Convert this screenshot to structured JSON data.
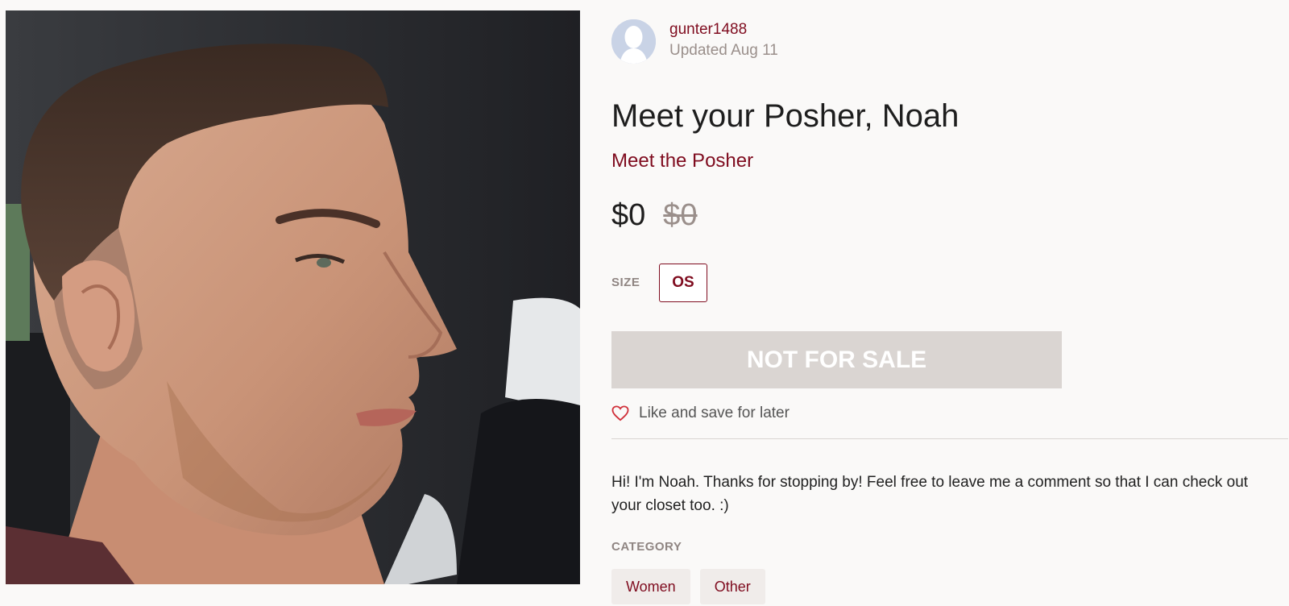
{
  "photo": {
    "alt_icon": "listing-photo"
  },
  "seller": {
    "username": "gunter1488",
    "updated": "Updated Aug 11"
  },
  "listing": {
    "title": "Meet your Posher, Noah",
    "brand": "Meet the Posher",
    "price": "$0",
    "original_price": "$0"
  },
  "size": {
    "label": "SIZE",
    "value": "OS"
  },
  "actions": {
    "status_button": "NOT FOR SALE",
    "like_label": "Like and save for later"
  },
  "description": "Hi! I'm Noah. Thanks for stopping by! Feel free to leave me a comment so that I can check out your closet too. :)",
  "category": {
    "label": "CATEGORY",
    "items": [
      "Women",
      "Other"
    ]
  },
  "colors": {
    "accent": "#7f0c1f",
    "muted": "#9a8f8b",
    "button_bg": "#dad5d2",
    "chip_bg": "#f0ecea"
  }
}
